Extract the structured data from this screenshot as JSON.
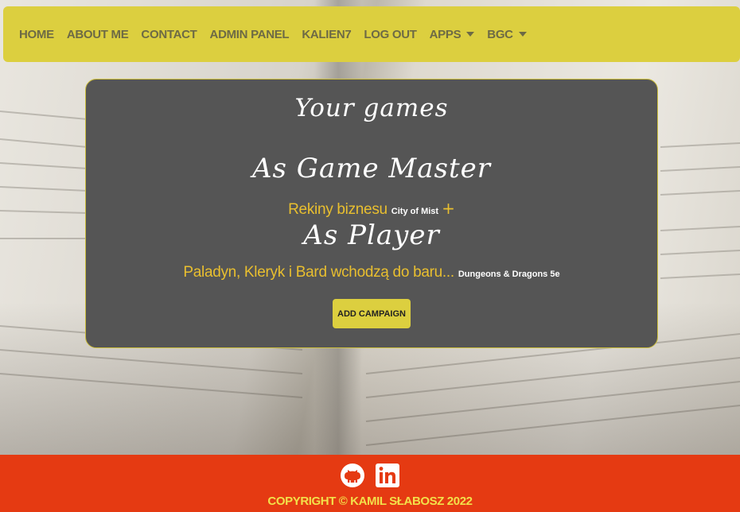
{
  "nav": {
    "items": [
      {
        "label": "Home"
      },
      {
        "label": "About me"
      },
      {
        "label": "Contact"
      },
      {
        "label": "Admin panel"
      },
      {
        "label": "Kalien7"
      },
      {
        "label": "Log out"
      },
      {
        "label": "Apps",
        "dropdown": true
      },
      {
        "label": "BGC",
        "dropdown": true
      }
    ]
  },
  "main": {
    "title": "Your games",
    "game_master": {
      "heading": "As Game Master",
      "games": [
        {
          "title": "Rekiny biznesu",
          "system": "City of Mist",
          "add_icon": "plus-icon"
        }
      ]
    },
    "player": {
      "heading": "As Player",
      "games": [
        {
          "title": "Paladyn, Kleryk i Bard wchodzą do baru...",
          "system": "Dungeons & Dragons 5e"
        }
      ]
    },
    "add_campaign_label": "Add campaign"
  },
  "footer": {
    "icons": [
      "github-icon",
      "linkedin-icon"
    ],
    "copyright": "Copyright © Kamil Słabosz 2022"
  },
  "colors": {
    "navbar": "#dccf3f",
    "card": "#555555",
    "accent": "#e9bf2f",
    "footer": "#e53a12",
    "footer_text": "#f2e04a"
  }
}
